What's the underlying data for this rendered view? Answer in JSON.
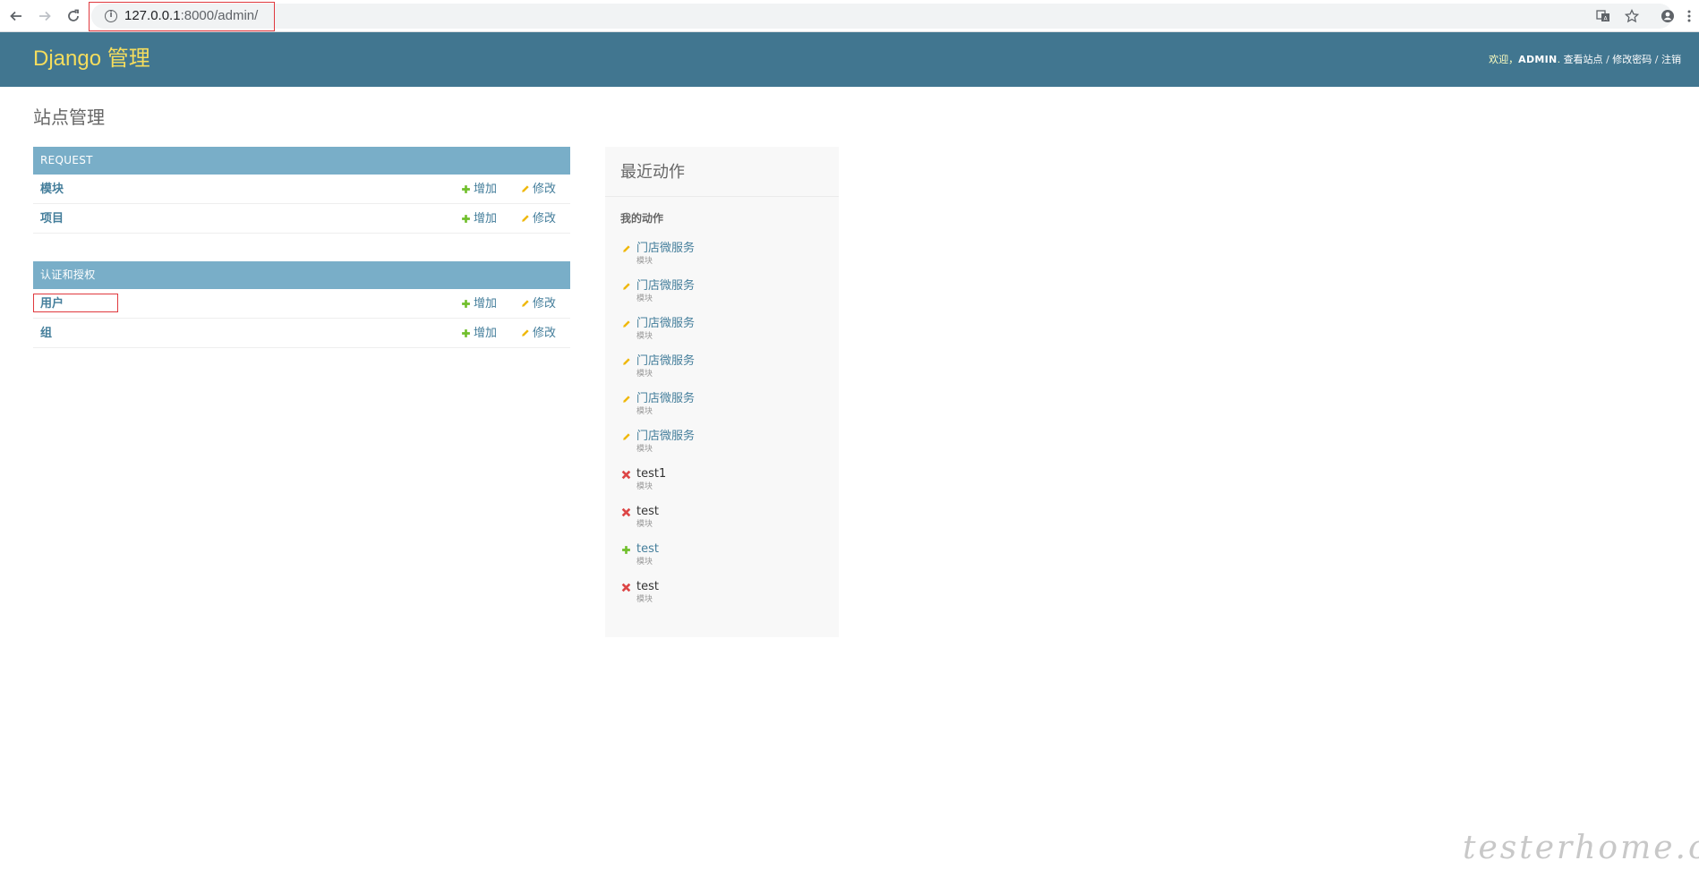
{
  "browser": {
    "url_host": "127.0.0.1",
    "url_rest": ":8000/admin/",
    "icons": {
      "back": "back-arrow-icon",
      "forward": "forward-arrow-icon",
      "reload": "reload-icon",
      "info": "site-info-icon",
      "translate": "translate-icon",
      "bookmark": "star-icon",
      "profile": "account-icon",
      "menu": "menu-dots-icon"
    }
  },
  "header": {
    "branding": "Django 管理",
    "welcome": "欢迎，",
    "username": "ADMIN",
    "view_site": "查看站点",
    "change_password": "修改密码",
    "logout": "注销",
    "separator": "/",
    "dot": ".",
    "colors": {
      "header_bg": "#417690",
      "branding": "#f5dd5d",
      "caption_bg": "#79aec8"
    }
  },
  "page_title": "站点管理",
  "modules": [
    {
      "caption": "REQUEST",
      "rows": [
        {
          "name": "模块",
          "add": "增加",
          "change": "修改"
        },
        {
          "name": "项目",
          "add": "增加",
          "change": "修改"
        }
      ]
    },
    {
      "caption": "认证和授权",
      "rows": [
        {
          "name": "用户",
          "add": "增加",
          "change": "修改"
        },
        {
          "name": "组",
          "add": "增加",
          "change": "修改"
        }
      ]
    }
  ],
  "recent_actions": {
    "title": "最近动作",
    "subtitle": "我的动作",
    "items": [
      {
        "label": "门店微服务",
        "type": "模块",
        "action": "change"
      },
      {
        "label": "门店微服务",
        "type": "模块",
        "action": "change"
      },
      {
        "label": "门店微服务",
        "type": "模块",
        "action": "change"
      },
      {
        "label": "门店微服务",
        "type": "模块",
        "action": "change"
      },
      {
        "label": "门店微服务",
        "type": "模块",
        "action": "change"
      },
      {
        "label": "门店微服务",
        "type": "模块",
        "action": "change"
      },
      {
        "label": "test1",
        "type": "模块",
        "action": "delete"
      },
      {
        "label": "test",
        "type": "模块",
        "action": "delete"
      },
      {
        "label": "test",
        "type": "模块",
        "action": "add"
      },
      {
        "label": "test",
        "type": "模块",
        "action": "delete"
      }
    ],
    "colors": {
      "change": "#efb80b",
      "delete": "#dd4646",
      "add": "#70bf2b",
      "link": "#447e9b"
    }
  },
  "watermark": "testerhome.com"
}
